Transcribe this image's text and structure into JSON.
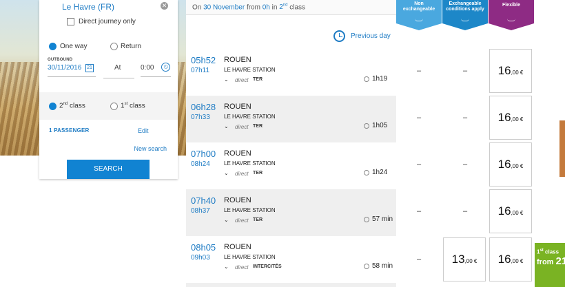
{
  "search": {
    "destination": "Le Havre (FR)",
    "direct_journey_label": "Direct journey only",
    "trip_types": [
      {
        "label": "One way",
        "selected": true
      },
      {
        "label": "Return",
        "selected": false
      }
    ],
    "outbound_label": "OUTBOUND",
    "date_value": "30/11/2016",
    "calendar_icon_text": "21",
    "at_label": "At",
    "time_value": "0:00",
    "classes": [
      {
        "num": "2",
        "sup": "nd",
        "suffix": "class",
        "selected": true
      },
      {
        "num": "1",
        "sup": "st",
        "suffix": "class",
        "selected": false
      }
    ],
    "passengers_label": "1 PASSENGER",
    "edit_label": "Edit",
    "new_search_label": "New search",
    "search_button_label": "SEARCH"
  },
  "results": {
    "header": {
      "prefix": "On",
      "date": "30 November",
      "mid": "from",
      "hour": "0h",
      "in": "in",
      "class_num": "2",
      "class_sup": "nd",
      "class_word": "class"
    },
    "previous_day_label": "Previous day",
    "trips": [
      {
        "dep": "05h52",
        "arr": "07h11",
        "dest": "ROUEN",
        "origin": "LE HAVRE STATION",
        "direct": "direct",
        "type": "TER",
        "duration": "1h19"
      },
      {
        "dep": "06h28",
        "arr": "07h33",
        "dest": "ROUEN",
        "origin": "LE HAVRE STATION",
        "direct": "direct",
        "type": "TER",
        "duration": "1h05"
      },
      {
        "dep": "07h00",
        "arr": "08h24",
        "dest": "ROUEN",
        "origin": "LE HAVRE STATION",
        "direct": "direct",
        "type": "TER",
        "duration": "1h24"
      },
      {
        "dep": "07h40",
        "arr": "08h37",
        "dest": "ROUEN",
        "origin": "LE HAVRE STATION",
        "direct": "direct",
        "type": "TER",
        "duration": "57 min"
      },
      {
        "dep": "08h05",
        "arr": "09h03",
        "dest": "ROUEN",
        "origin": "LE HAVRE STATION",
        "direct": "direct",
        "type": "INTERCITÉS",
        "duration": "58 min"
      }
    ]
  },
  "fares": {
    "columns": [
      {
        "line1": "Non",
        "line2": "exchangeable",
        "color": "#4aa8df"
      },
      {
        "line1": "Exchangeable",
        "line2": "conditions apply",
        "color": "#1d87c8"
      },
      {
        "line1": "Flexible",
        "line2": "",
        "color": "#8e2b84"
      }
    ],
    "rows": [
      {
        "non_exchangeable": "–",
        "exchangeable": "–",
        "exchangeable_cents": "",
        "flexible": "16",
        "flexible_cents": ",00 €"
      },
      {
        "non_exchangeable": "–",
        "exchangeable": "–",
        "exchangeable_cents": "",
        "flexible": "16",
        "flexible_cents": ",00 €"
      },
      {
        "non_exchangeable": "–",
        "exchangeable": "–",
        "exchangeable_cents": "",
        "flexible": "16",
        "flexible_cents": ",00 €"
      },
      {
        "non_exchangeable": "–",
        "exchangeable": "–",
        "exchangeable_cents": "",
        "flexible": "16",
        "flexible_cents": ",00 €"
      },
      {
        "non_exchangeable": "–",
        "exchangeable": "13",
        "exchangeable_cents": ",00 €",
        "flexible": "16",
        "flexible_cents": ",00 €"
      }
    ]
  },
  "promo": {
    "class_num": "1",
    "class_sup": "st",
    "class_word": "class",
    "from_word": "from",
    "amount": "21"
  }
}
